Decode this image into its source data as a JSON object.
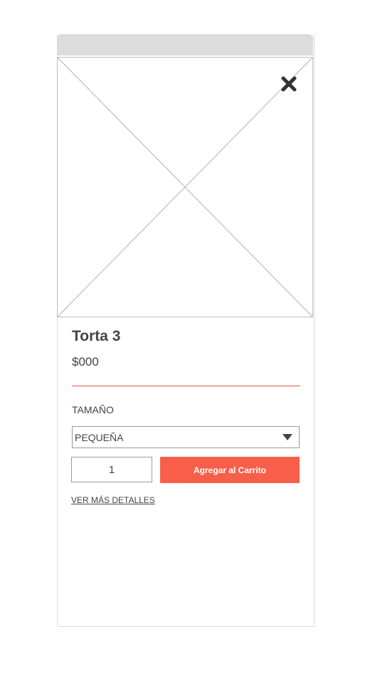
{
  "product": {
    "title": "Torta 3",
    "price": "$000"
  },
  "size": {
    "label": "TAMAÑO",
    "selected": "PEQUEÑA"
  },
  "quantity": {
    "value": "1"
  },
  "actions": {
    "add_to_cart_label": "Agregar al Carrito",
    "more_details_label": "VER MÁS DETALLES"
  },
  "colors": {
    "accent": "#f85f4a",
    "divider": "#e0533b",
    "topbar": "#dcdcdc",
    "text": "#444444"
  },
  "icons": {
    "close": "close-icon",
    "dropdown": "chevron-down-icon",
    "image": "image-placeholder-icon"
  }
}
